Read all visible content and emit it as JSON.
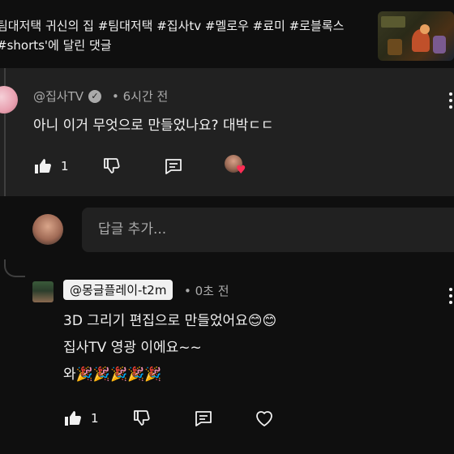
{
  "video": {
    "title": "팀대저택 귀신의 집 #팀대저택 #집사tv #멜로우 #료미 #로블록스\n#shorts'에 달린 댓글"
  },
  "comment": {
    "author": "@집사TV",
    "verified_icon": "verified-check-icon",
    "time": "• 6시간 전",
    "text": "아니 이거 무엇으로 만들었나요? 대박ㄷㄷ",
    "like_count": "1",
    "hearted_badge": "♥"
  },
  "reply_box": {
    "placeholder": "답글 추가..."
  },
  "reply": {
    "author": "@몽글플레이-t2m",
    "time": "• 0초 전",
    "lines": [
      "3D 그리기 편집으로 만들었어요😊😊",
      "집사TV 영광 이에요~~",
      "와🎉🎉🎉🎉🎉"
    ],
    "like_count": "1"
  },
  "colors": {
    "background": "#0f0f0f",
    "panel": "#212121",
    "text_primary": "#f1f1f1",
    "text_secondary": "#aaaaaa",
    "heart": "#ff2d55"
  }
}
